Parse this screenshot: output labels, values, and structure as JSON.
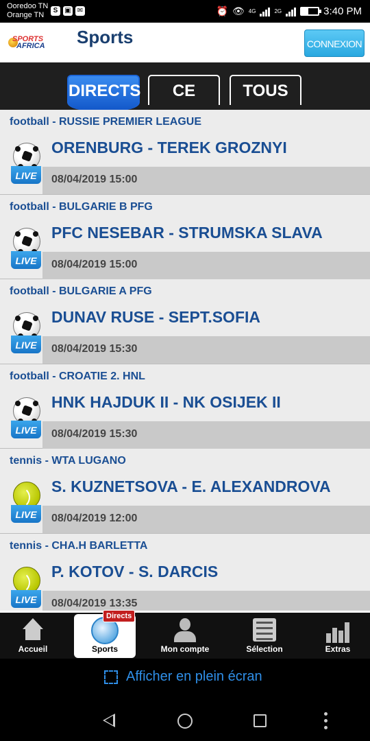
{
  "status_bar": {
    "carrier1": "Ooredoo TN",
    "carrier2": "Orange TN",
    "network1": "4G",
    "network2": "2G",
    "time": "3:40 PM"
  },
  "header": {
    "logo_line1": "SPORTS",
    "logo_line2": "AFRICA",
    "title": "Sports",
    "connexion_label": "CONNEXION"
  },
  "tabs": [
    {
      "label": "DIRECTS",
      "active": true
    },
    {
      "label": "CE JOUR",
      "active": false
    },
    {
      "label": "TOUS",
      "active": false
    }
  ],
  "live_label": "LIVE",
  "matches": [
    {
      "league": "football - RUSSIE PREMIER LEAGUE",
      "teams": "ORENBURG - TEREK GROZNYI",
      "datetime": "08/04/2019 15:00",
      "sport": "football"
    },
    {
      "league": "football - BULGARIE B PFG",
      "teams": "PFC NESEBAR - STRUMSKA SLAVA",
      "datetime": "08/04/2019 15:00",
      "sport": "football"
    },
    {
      "league": "football - BULGARIE A PFG",
      "teams": "DUNAV RUSE - SEPT.SOFIA",
      "datetime": "08/04/2019 15:30",
      "sport": "football"
    },
    {
      "league": "football - CROATIE 2. HNL",
      "teams": "HNK HAJDUK II - NK OSIJEK II",
      "datetime": "08/04/2019 15:30",
      "sport": "football"
    },
    {
      "league": "tennis - WTA LUGANO",
      "teams": "S. KUZNETSOVA - E. ALEXANDROVA",
      "datetime": "08/04/2019 12:00",
      "sport": "tennis"
    },
    {
      "league": "tennis - CHA.H BARLETTA",
      "teams": "P. KOTOV - S. DARCIS",
      "datetime": "08/04/2019 13:35",
      "sport": "tennis"
    }
  ],
  "bottom_nav": {
    "home": "Accueil",
    "sports": "Sports",
    "sports_badge": "Directs",
    "account": "Mon compte",
    "selection": "Sélection",
    "extras": "Extras"
  },
  "fullscreen_label": "Afficher en plein écran",
  "colors": {
    "accent": "#1a4e93",
    "live_blue": "#1875c7",
    "badge_red": "#c21e1e",
    "link_blue": "#2f8fe8"
  }
}
